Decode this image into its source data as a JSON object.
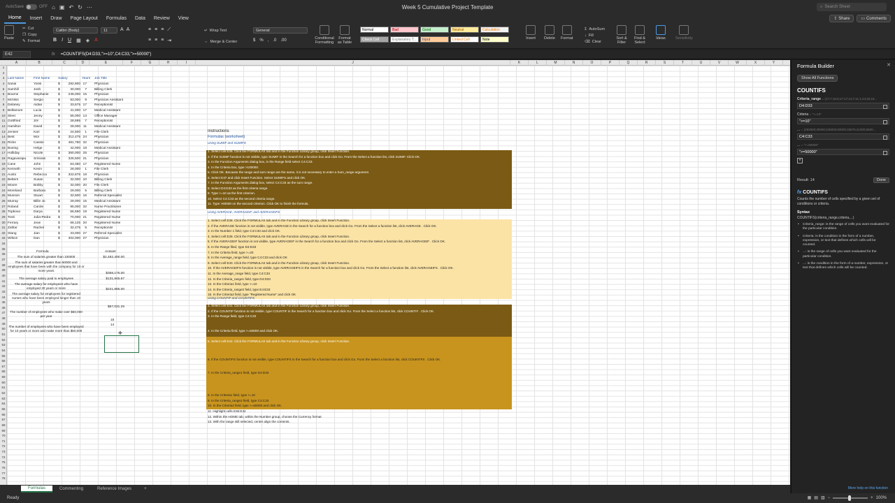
{
  "app": {
    "title": "Week 5 Cumulative Project Template",
    "autosave": "AutoSave",
    "autosave_state": "OFF",
    "search_placeholder": "Search Sheet"
  },
  "ribbon_tabs": [
    "Home",
    "Insert",
    "Draw",
    "Page Layout",
    "Formulas",
    "Data",
    "Review",
    "View"
  ],
  "share": {
    "share_label": "Share",
    "comments_label": "Comments"
  },
  "ribbon": {
    "paste": "Paste",
    "cut": "Cut",
    "copy": "Copy",
    "format": "Format",
    "font": "Calibri (Body)",
    "size": "11",
    "wrap": "Wrap Text",
    "merge": "Merge & Center",
    "numfmt": "General",
    "cond": "Conditional Formatting",
    "fmt_table": "Format as Table",
    "insert": "Insert",
    "delete": "Delete",
    "format_cells": "Format",
    "autosum": "AutoSum",
    "fill": "Fill",
    "clear": "Clear",
    "sort": "Sort & Filter",
    "find": "Find & Select",
    "ideas": "Ideas",
    "sensitivity": "Sensitivity",
    "styles": [
      {
        "label": "Normal",
        "bg": "#ffffff",
        "fg": "#000"
      },
      {
        "label": "Bad",
        "bg": "#ffc7ce",
        "fg": "#9c0006"
      },
      {
        "label": "Good",
        "bg": "#c6efce",
        "fg": "#006100"
      },
      {
        "label": "Neutral",
        "bg": "#ffeb9c",
        "fg": "#9c5700"
      },
      {
        "label": "Calculation",
        "bg": "#f2f2f2",
        "fg": "#fa7d00"
      },
      {
        "label": "Check Cell",
        "bg": "#a5a5a5",
        "fg": "#fff"
      },
      {
        "label": "Explanatory T...",
        "bg": "#ffffff",
        "fg": "#7f7f7f"
      },
      {
        "label": "Input",
        "bg": "#ffcc99",
        "fg": "#3f3f76"
      },
      {
        "label": "Linked Cell",
        "bg": "#ffffff",
        "fg": "#fa7d00"
      },
      {
        "label": "Note",
        "bg": "#ffffcc",
        "fg": "#000"
      }
    ]
  },
  "formula_bar": {
    "cell": "E42",
    "formula": "=COUNTIFS(D4:D33,\">=10\",C4:C33,\">=50000\")"
  },
  "columns": [
    "A",
    "B",
    "C",
    "D",
    "E",
    "F",
    "G",
    "H",
    "I",
    "J",
    "K",
    "L",
    "M",
    "N",
    "O",
    "P",
    "Q",
    "R",
    "S",
    "T",
    "U",
    "V",
    "W",
    "X",
    "Y"
  ],
  "headers": {
    "last": "Last Name",
    "first": "First Name",
    "salary": "Salary",
    "years": "Years",
    "job": "Job Title"
  },
  "employees": [
    [
      "Sanai",
      "Yossi",
      "$",
      "292,800",
      "17",
      "Physician"
    ],
    [
      "Samhill",
      "Josh",
      "$",
      "30,000",
      "7",
      "Billing Clerk"
    ],
    [
      "Bourne",
      "Stephanie",
      "$",
      "246,000",
      "15",
      "Physician"
    ],
    [
      "McNiss",
      "Sergio",
      "$",
      "83,000",
      "9",
      "Physician Assistant"
    ],
    [
      "Delaney",
      "Aidan",
      "$",
      "33,675",
      "17",
      "Receptionist"
    ],
    [
      "Bellamore",
      "Lucia",
      "$",
      "41,000",
      "17",
      "Medical Assistant"
    ],
    [
      "Sleet",
      "Jenny",
      "$",
      "55,000",
      "13",
      "Office Manager"
    ],
    [
      "Gottfried",
      "Jim",
      "$",
      "28,695",
      "7",
      "Receptionist"
    ],
    [
      "Hamilton",
      "David",
      "$",
      "28,000",
      "11",
      "Medical Assistant"
    ],
    [
      "Jensen",
      "Kari",
      "$",
      "24,500",
      "1",
      "File Clerk"
    ],
    [
      "Best",
      "Mor",
      "$",
      "312,475",
      "24",
      "Physician"
    ],
    [
      "Ricks",
      "Cassie",
      "$",
      "481,750",
      "32",
      "Physician"
    ],
    [
      "Boeing",
      "Helge",
      "$",
      "42,000",
      "18",
      "Medical Assistant"
    ],
    [
      "Holliday",
      "Nicole",
      "$",
      "360,000",
      "25",
      "Physician"
    ],
    [
      "Ragavarapu",
      "Srinivas",
      "$",
      "326,500",
      "21",
      "Physician"
    ],
    [
      "Cane",
      "John",
      "$",
      "63,350",
      "17",
      "Registered Nurse"
    ],
    [
      "Kenneth",
      "Kevin",
      "$",
      "26,000",
      "1",
      "File Clerk"
    ],
    [
      "Austo",
      "Rebecca",
      "$",
      "322,875",
      "18",
      "Physician"
    ],
    [
      "Betters",
      "Susan",
      "$",
      "32,000",
      "10",
      "Billing Clerk"
    ],
    [
      "Moore",
      "Bobby",
      "$",
      "32,000",
      "20",
      "File Clerk"
    ],
    [
      "Moreland",
      "Barbara",
      "$",
      "29,000",
      "5",
      "Billing Clerk"
    ],
    [
      "Munson",
      "Stuart",
      "$",
      "32,500",
      "16",
      "Referral Specialist"
    ],
    [
      "Murray",
      "Billie Jo",
      "$",
      "29,000",
      "15",
      "Medical Assistant"
    ],
    [
      "Roland",
      "Carole",
      "$",
      "95,000",
      "32",
      "Nurse Practitioner"
    ],
    [
      "Topkova",
      "Darya",
      "$",
      "66,650",
      "19",
      "Registered Nurse"
    ],
    [
      "Tosti",
      "Julia-Pedra",
      "$",
      "70,000",
      "21",
      "Registered Nurse"
    ],
    [
      "Ferrary",
      "Jean",
      "$",
      "68,125",
      "20",
      "Registered Nurse"
    ],
    [
      "Zahlar",
      "Rachel",
      "$",
      "32,475",
      "5",
      "Receptionist"
    ],
    [
      "Stang",
      "Jian",
      "$",
      "33,000",
      "27",
      "Referral Specialist"
    ],
    [
      "Wilson",
      "Dan",
      "$",
      "402,000",
      "27",
      "Physician"
    ]
  ],
  "summary": {
    "formula_hdr": "Formula",
    "answer_hdr": "Answer",
    "rows": [
      {
        "q": "The sum of salaries greater than 100000",
        "a": "$2,482,400.00"
      },
      {
        "q": "The sum of salaries greater than 60000 and employees that have been with the company for 10 or more years",
        "a": "$358,175.00"
      },
      {
        "q": "The average salary paid to employees",
        "a": "$131,845.67"
      },
      {
        "q": "The average salary for employees who have employed 20 years or more",
        "a": "$221,885.00"
      },
      {
        "q": "The average salary for employees for registered nurses who have been employed longer than 10 years",
        "a": "$67,031.25"
      },
      {
        "q": "The number of employees who make over $50,000 per year",
        "a": "15"
      },
      {
        "q": "The number of employees who have been employed for 10 years or more and make more than $50,000",
        "a": "14"
      }
    ]
  },
  "instructions": {
    "title": "Instructions",
    "sub1": "Formulas (worksheet)",
    "s1": "Using SUMIF and SUMIFS",
    "l1": [
      "1. Select cell E36. Click the FORMULAS tab and in the Function Library group, click Insert Function.",
      "2. If the SUMIF function is not visible, type SUMIF in the Search for a function box and click Go. From the Select a function list, click SUMIF. Click OK.",
      "3. In the Function Arguments dialog box, in the Range field select C4:C33.",
      "4. In the Criteria box, type >100000.",
      "5. Click OK. Because the range and sum range are the same, it is not necessary to enter a Sum_range argument.",
      "6. Select E37 and click Insert Function. Select SUMIFS and click OK.",
      "7. In the Function Arguments dialog box, select C4:C33 as the sum range.",
      "8. Select D4:D33 as the first criteria range.",
      "9. Type >=10 as the first criterion.",
      "10. Select C4:C33 as the second criteria range.",
      "11. Type >60000 on the second criterion. Click OK to finish the formula."
    ],
    "s2": "Using AVERAGE, AVERAGEIF, and AVERAGEIFS",
    "l2": [
      "1. Select cell E38. Click the FORMULAS tab and in the Function Library group, click Insert Function.",
      "2. If the AVERAGE function is not visible, type AVERAGE in the Search for a function box and click Go. From the Select a function list, click AVERAGE . Click OK.",
      "3. In the Number 1 field, type C4:C33 and click OK.",
      "4. Select cell E39. Click the FORMULAS tab and in the Function Library group, click Insert Function.",
      "5. If the AVERAGEIF function is not visible, type AVERAGEIF in the Search for a function box and click Go. From the Select a function list, click AVERAGEIF . Click OK.",
      "6. In the Range filed, type D4:D33",
      "7. In the Criteria field, type >=20",
      "8. In the Average_range field, type C4:C33 and click OK",
      "9. Select cell E40. Click the FORMULAS tab and in the Function Library group, click Insert Function.",
      "10. If the AVERAGEIFS function is not visible, type AVERAGEIFS in the Search for a function box and click Go. From the Select a function list, click AVERAGEIFS . Click OK.",
      "11. In the Average_range field, type C4:C33",
      "12. In the Criteria_range1 field, type D4:D33",
      "13. In the Criteria1 field, type >=10",
      "14. In the Criteria_range2 field, type E4:E33",
      "15. In the Criteria2 field, type \"Registered Nurse\" and click OK"
    ],
    "s3": "Using COUNTIF and COUNTIFS",
    "l3a": [
      "1. Select cell E41. Click the FORMULAS tab and in the Function Library group, click Insert Function.",
      "2. If the COUNTIF function is not visible, type COUNTIF in the Search for a function box and click Go. From the Select a function list, click COUNTIF . Click OK.",
      "3. In the Range field, type C4:C33"
    ],
    "l3b": "4. In the Criteria field, type >=50000 and click OK.",
    "l3c": "5. Select cell E42. Click the FORMULAS tab and in the Function Library group, click Insert Function.",
    "l3d": "6. If the COUNTIFS function is not visible, type COUNTIFS in the Search for a function box and click Go. From the Select a function list, click COUNTIFS . Click OK.",
    "l3e": "7. In the Criteria_range1 field, type D4:D33",
    "l3f": [
      "8. In the Criteria1 field, type >=10",
      "9. In the Criteria_range2 field, type C4:C33",
      "10. In the Criteria2 field, type >=50000 and click OK."
    ],
    "l4": [
      "11. Highlight cells E36:E42",
      "12. Within the HOME tab, within the Number group, choose the Currency format",
      "13. With the range still selected, center align the contents."
    ]
  },
  "sheets": [
    "Formulas",
    "Commenting",
    "Reference Images"
  ],
  "status": {
    "ready": "Ready",
    "zoom": "100%"
  },
  "builder": {
    "title": "Formula Builder",
    "show_all": "Show All Functions",
    "fname": "COUNTIFS",
    "a1_label": "Criteria_range",
    "a1_val": "= {17;7;15;9;17;17;13;7;11;1;24;32;18...",
    "a1_box": "D4:D33",
    "a2_label": "Criteria",
    "a2_val": "= \">=10\"",
    "a2_box": "\">=10\"",
    "a3_label": "...",
    "a3_val": "= {292800;30000;246000;83000;33675;41000;5500...",
    "a3_box": "C4:C33",
    "a4_label": "...",
    "a4_val": "= \">=50000\"",
    "a4_box": "\">=50000\"",
    "result": "Result: 14",
    "done": "Done",
    "help_name": "COUNTIFS",
    "help_desc": "Counts the number of cells specified by a given set of conditions or criteria.",
    "syntax_label": "Syntax",
    "syntax": "COUNTIFS(criteria_range,criteria,...)",
    "bullets": [
      "Criteria_range: is the range of cells you want evaluated for the particular condition.",
      "Criteria: is the condition in the form of a number, expression, or text that defines which cells will be counted.",
      "...: is the range of cells you want evaluated for the particular condition.",
      "...: is the condition in the form of a number, expression, or text that defines which cells will be counted."
    ],
    "more_help": "More help on this function"
  }
}
